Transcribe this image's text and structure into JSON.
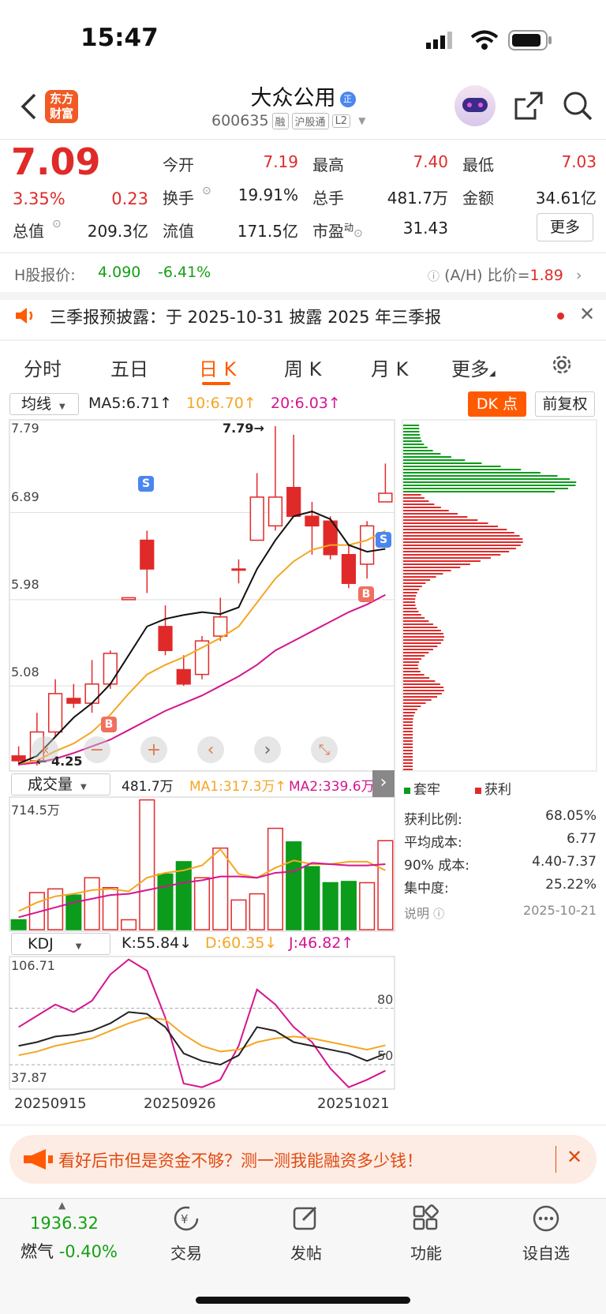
{
  "status": {
    "time": "15:47"
  },
  "header": {
    "logo_text": "东方财富",
    "stock_name": "大众公用",
    "badge": "正",
    "code": "600635",
    "tags": [
      "融",
      "沪股通",
      "L2"
    ]
  },
  "quote": {
    "price": "7.09",
    "change_pct": "3.35%",
    "change": "0.23",
    "rows": [
      {
        "l1": "今开",
        "v1": "7.19",
        "l2": "最高",
        "v2": "7.40",
        "l3": "最低",
        "v3": "7.03"
      },
      {
        "l1": "换手",
        "v1": "19.91%",
        "l2": "总手",
        "v2": "481.7万",
        "l3": "金额",
        "v3": "34.61亿"
      },
      {
        "l1": "总值",
        "v1": "209.3亿",
        "l2": "流值",
        "v2": "171.5亿",
        "l3": "市盈",
        "l3sup": "动",
        "v3": "31.43"
      }
    ],
    "more_button": "更多"
  },
  "hshare": {
    "label": "H股报价:",
    "price": "4.090",
    "change": "-6.41%",
    "ratio_label": "(A/H) 比价=",
    "ratio": "1.89"
  },
  "notice": {
    "text": "三季报预披露：于 2025-10-31 披露 2025 年三季报"
  },
  "tabs": [
    "分时",
    "五日",
    "日 K",
    "周 K",
    "月 K",
    "更多"
  ],
  "active_tab": 2,
  "ma_bar": {
    "select": "均线",
    "ma5": "MA5:6.71↑",
    "ma10": "10:6.70↑",
    "ma20": "20:6.03↑",
    "dk": "DK 点",
    "fq": "前复权"
  },
  "kline": {
    "y_labels": [
      "7.79",
      "6.89",
      "5.98",
      "5.08"
    ],
    "high_mark": "7.79→",
    "low_mark": "← 4.25"
  },
  "volume": {
    "select": "成交量",
    "value": "481.7万",
    "ma1": "MA1:317.3万↑",
    "ma2": "MA2:339.6万↑",
    "max": "714.5万"
  },
  "kdj": {
    "select": "KDJ",
    "k": "K:55.84↓",
    "d": "D:60.35↓",
    "j": "J:46.82↑",
    "ymax": "106.71",
    "ymin": "37.87",
    "l80": "80",
    "l50": "50"
  },
  "dates": [
    "20250915",
    "20250926",
    "20251021"
  ],
  "chip": {
    "legend_tao": "套牢",
    "legend_huo": "获利",
    "stats": [
      {
        "label": "获利比例:",
        "value": "68.05%"
      },
      {
        "label": "平均成本:",
        "value": "6.77"
      },
      {
        "label": "90% 成本:",
        "value": "4.40-7.37"
      },
      {
        "label": "集中度:",
        "value": "25.22%"
      }
    ],
    "note": "说明",
    "date": "2025-10-21"
  },
  "banner": {
    "text": "看好后市但是资金不够？测一测我能融资多少钱！"
  },
  "bottom": {
    "index_value": "1936.32",
    "index_name": "燃气",
    "index_change": "-0.40%",
    "items": [
      "交易",
      "发帖",
      "功能",
      "设自选"
    ]
  },
  "colors": {
    "up": "#e02a2a",
    "down": "#0a9c1a",
    "ma10": "#f5a623",
    "ma20": "#d4158f",
    "accent": "#ff5a00"
  },
  "chart_data": {
    "type": "candlestick",
    "candles": [
      {
        "o": 4.35,
        "c": 4.3,
        "h": 4.45,
        "l": 4.25
      },
      {
        "o": 4.3,
        "c": 4.6,
        "h": 4.8,
        "l": 4.25
      },
      {
        "o": 4.6,
        "c": 5.0,
        "h": 5.15,
        "l": 4.55
      },
      {
        "o": 4.95,
        "c": 4.9,
        "h": 5.1,
        "l": 4.85
      },
      {
        "o": 4.9,
        "c": 5.1,
        "h": 5.35,
        "l": 4.8
      },
      {
        "o": 5.1,
        "c": 5.42,
        "h": 5.45,
        "l": 5.05
      },
      {
        "o": 5.98,
        "c": 6.0,
        "h": 6.0,
        "l": 5.98
      },
      {
        "o": 6.6,
        "c": 6.3,
        "h": 6.7,
        "l": 6.05
      },
      {
        "o": 5.7,
        "c": 5.45,
        "h": 5.92,
        "l": 5.4
      },
      {
        "o": 5.25,
        "c": 5.1,
        "h": 5.4,
        "l": 5.08
      },
      {
        "o": 5.2,
        "c": 5.55,
        "h": 5.6,
        "l": 5.15
      },
      {
        "o": 5.6,
        "c": 5.8,
        "h": 6.0,
        "l": 5.55
      },
      {
        "o": 6.3,
        "c": 6.3,
        "h": 6.4,
        "l": 6.15
      },
      {
        "o": 6.6,
        "c": 7.05,
        "h": 7.3,
        "l": 6.6
      },
      {
        "o": 6.75,
        "c": 7.05,
        "h": 7.79,
        "l": 6.7
      },
      {
        "o": 7.15,
        "c": 6.85,
        "h": 7.7,
        "l": 6.85
      },
      {
        "o": 6.85,
        "c": 6.75,
        "h": 7.0,
        "l": 6.45
      },
      {
        "o": 6.8,
        "c": 6.45,
        "h": 6.85,
        "l": 6.4
      },
      {
        "o": 6.45,
        "c": 6.15,
        "h": 6.55,
        "l": 6.1
      },
      {
        "o": 6.35,
        "c": 6.75,
        "h": 6.8,
        "l": 6.2
      },
      {
        "o": 7.0,
        "c": 7.09,
        "h": 7.4,
        "l": 7.03
      }
    ],
    "ma5": [
      4.27,
      4.35,
      4.55,
      4.75,
      4.9,
      5.1,
      5.4,
      5.7,
      5.78,
      5.82,
      5.85,
      5.83,
      5.9,
      6.3,
      6.6,
      6.85,
      6.9,
      6.82,
      6.55,
      6.48,
      6.51
    ],
    "ma10": [
      4.27,
      4.3,
      4.4,
      4.48,
      4.6,
      4.78,
      5.0,
      5.2,
      5.3,
      5.38,
      5.48,
      5.58,
      5.7,
      5.95,
      6.2,
      6.38,
      6.5,
      6.55,
      6.55,
      6.6,
      6.7
    ],
    "ma20": [
      4.26,
      4.28,
      4.32,
      4.38,
      4.45,
      4.52,
      4.62,
      4.72,
      4.82,
      4.9,
      4.98,
      5.08,
      5.18,
      5.3,
      5.45,
      5.55,
      5.65,
      5.75,
      5.85,
      5.93,
      6.03
    ],
    "volume": [
      0.8,
      3.0,
      3.3,
      2.8,
      4.2,
      3.4,
      0.8,
      10.5,
      4.5,
      5.5,
      4.2,
      6.6,
      2.4,
      2.9,
      8.2,
      7.1,
      5.1,
      3.8,
      3.9,
      3.8,
      7.2
    ],
    "vol_up": [
      false,
      true,
      true,
      false,
      true,
      true,
      true,
      true,
      false,
      false,
      true,
      true,
      true,
      true,
      true,
      false,
      false,
      false,
      false,
      true,
      true
    ],
    "vol_ma1": [
      1.5,
      2.2,
      2.7,
      2.9,
      3.2,
      3.3,
      3.1,
      4.2,
      4.6,
      4.8,
      5.2,
      6.5,
      4.5,
      4.2,
      5.0,
      5.6,
      5.3,
      5.3,
      5.5,
      5.5,
      4.8
    ],
    "vol_ma2": [
      1.0,
      1.4,
      1.8,
      2.2,
      2.5,
      2.8,
      2.9,
      3.2,
      3.5,
      3.8,
      4.0,
      4.3,
      4.3,
      4.2,
      4.6,
      4.7,
      5.4,
      5.3,
      5.2,
      5.2,
      5.3
    ],
    "kdj_k": [
      60,
      62,
      65,
      66,
      68,
      72,
      78,
      77,
      70,
      56,
      52,
      50,
      55,
      70,
      68,
      62,
      60,
      58,
      56,
      52,
      55.84
    ],
    "kdj_d": [
      55,
      57,
      60,
      62,
      64,
      68,
      72,
      75,
      74,
      66,
      60,
      57,
      58,
      62,
      64,
      65,
      64,
      62,
      60,
      58,
      60.35
    ],
    "kdj_j": [
      70,
      76,
      82,
      78,
      84,
      98,
      106,
      100,
      75,
      40,
      38,
      42,
      60,
      90,
      82,
      70,
      62,
      48,
      38,
      42,
      46.82
    ]
  }
}
